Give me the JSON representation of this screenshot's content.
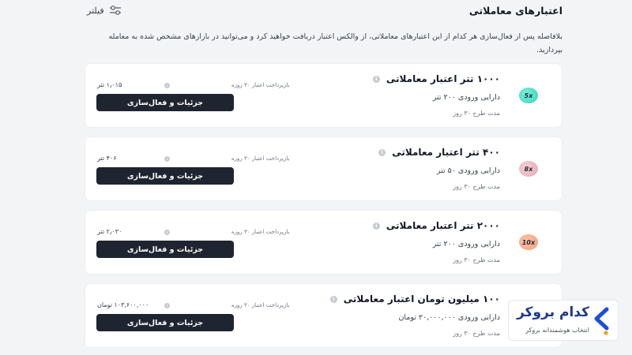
{
  "header": {
    "title": "اعتبارهای معاملاتی",
    "filter_label": "فیلتر"
  },
  "intro": "بلافاصله پس از فعال‌سازی هر کدام از این اعتبارهای معاملاتی، از والکس اعتبار دریافت خواهید کرد و می‌توانید در بازارهای مشخص شده به معامله بپردازید.",
  "cards": [
    {
      "badge": "5x",
      "badge_color": "#2dd4bf",
      "title": "۱۰۰۰ تتر اعتبار معاملاتی",
      "entry": "دارایی ورودی ۲۰۰ تتر",
      "period": "مدت طرح ۳۰ روز",
      "payback": "بازپرداخت اعتبار ۳۰ روزه",
      "amount": "۱٫۰۱۵ تتر",
      "cta": "جزئیات و فعال‌سازی"
    },
    {
      "badge": "8x",
      "badge_color": "#e5a7b3",
      "title": "۴۰۰ تتر اعتبار معاملاتی",
      "entry": "دارایی ورودی ۵۰ تتر",
      "period": "مدت طرح ۳۰ روز",
      "payback": "بازپرداخت اعتبار ۳۰ روزه",
      "amount": "۴۰۶ تتر",
      "cta": "جزئیات و فعال‌سازی"
    },
    {
      "badge": "10x",
      "badge_color": "#f49b78",
      "title": "۲۰۰۰ تتر اعتبار معاملاتی",
      "entry": "دارایی ورودی ۲۰۰ تتر",
      "period": "مدت طرح ۳۰ روز",
      "payback": "بازپرداخت اعتبار ۳۰ روزه",
      "amount": "۲٫۰۳۰ تتر",
      "cta": "جزئیات و فعال‌سازی"
    },
    {
      "badge": "",
      "badge_color": "#7cc4f5",
      "title": "۱۰۰ میلیون تومان اعتبار معاملاتی",
      "entry": "دارایی ورودی ۲۰,۰۰۰,۰۰۰ تومان",
      "period": "مدت طرح ۳۰ روز",
      "payback": "بازپرداخت اعتبار ۳۰ روزه",
      "amount": "۱۰۳,۶۰۰,۰۰۰ تومان",
      "cta": "جزئیات و فعال‌سازی"
    }
  ],
  "brand": {
    "name": "کدام بروکر",
    "tagline": "انتخاب هوشمندانه بروکر",
    "accent": "#1d4ed8",
    "dot_color": "#f59e0b"
  },
  "icons": {
    "filter": "sliders-icon",
    "info": "info-icon",
    "logo": "chevron-logo-icon"
  }
}
